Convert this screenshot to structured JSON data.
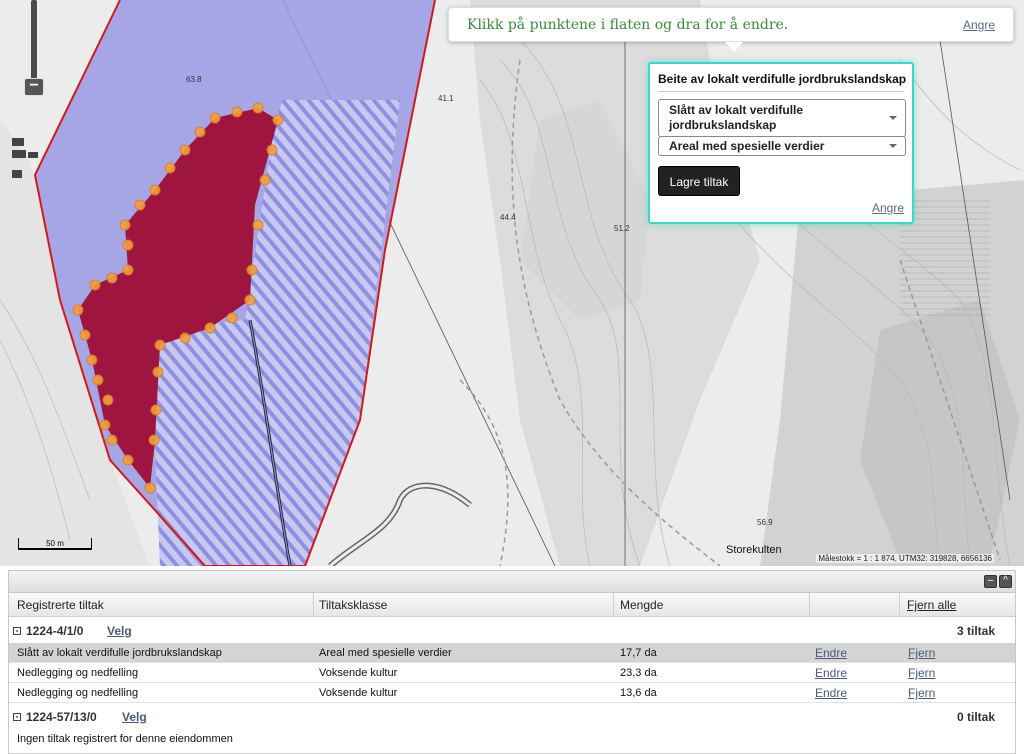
{
  "map": {
    "hint": {
      "text": "Klikk på punktene i flaten og dra for å endre.",
      "undo": "Angre"
    },
    "popup": {
      "title": "Beite av lokalt verdifulle jordbrukslandskap",
      "select1": "Slått av lokalt verdifulle jordbrukslandskap",
      "select2": "Areal med spesielle verdier",
      "save": "Lagre tiltak",
      "undo": "Angre"
    },
    "elevations": [
      "63.8",
      "41.1",
      "44.4",
      "51.2",
      "56.9"
    ],
    "place": "Storekulten",
    "scale_bar": "50 m",
    "scale_info": "Målestokk = 1 : 1 874, UTM32: 319828, 6656136",
    "colors": {
      "polygon_selected": "#9e1540",
      "polygon_fill": "#9a9ae6",
      "outline": "#d21a1a",
      "vertex": "#f0a040",
      "popup_border": "#3ed6c9",
      "hint_text": "#3d8a3d"
    }
  },
  "panel": {
    "headers": {
      "registered": "Registrerte tiltak",
      "class": "Tiltaksklasse",
      "amount": "Mengde",
      "remove_all": "Fjern alle"
    },
    "groups": [
      {
        "toggle": "-",
        "name": "1224-4/1/0",
        "select": "Velg",
        "count": "3 tiltak",
        "rows": [
          {
            "tiltak": "Slått av lokalt verdifulle jordbrukslandskap",
            "klasse": "Areal med spesielle verdier",
            "mengde": "17,7 da",
            "edit": "Endre",
            "remove": "Fjern"
          },
          {
            "tiltak": "Nedlegging og nedfelling",
            "klasse": "Voksende kultur",
            "mengde": "23,3 da",
            "edit": "Endre",
            "remove": "Fjern"
          },
          {
            "tiltak": "Nedlegging og nedfelling",
            "klasse": "Voksende kultur",
            "mengde": "13,6 da",
            "edit": "Endre",
            "remove": "Fjern"
          }
        ]
      },
      {
        "toggle": "-",
        "name": "1224-57/13/0",
        "select": "Velg",
        "count": "0 tiltak",
        "empty": "Ingen tiltak registrert for denne eiendommen"
      }
    ]
  }
}
